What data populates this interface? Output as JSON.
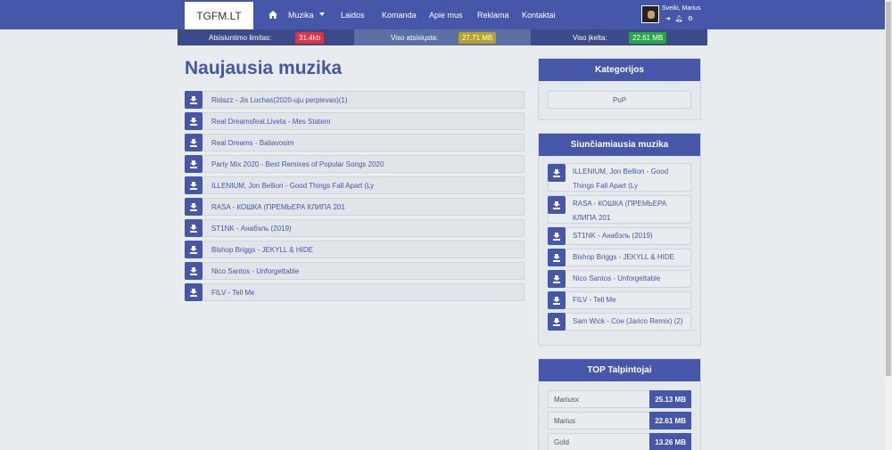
{
  "navbar": {
    "brand": "TGFM.LT",
    "items": [
      {
        "label": "Muzika",
        "has_dropdown": true
      },
      {
        "label": "Laidos"
      },
      {
        "label": "Komanda"
      },
      {
        "label": "Apie mus"
      },
      {
        "label": "Reklama"
      },
      {
        "label": "Kontaktai"
      }
    ],
    "user": {
      "greeting": "Sveiki, Marius",
      "icons": [
        "logout-icon",
        "bell-icon",
        "gear-icon"
      ]
    }
  },
  "stats": {
    "download_limit_label": "Atsisiuntimo limitas:",
    "download_limit_value": "31.4kb",
    "total_downloaded_label": "Viso atsisiųsta:",
    "total_downloaded_value": "27.71 MB",
    "total_uploaded_label": "Viso įkelta:",
    "total_uploaded_value": "22.61 MB"
  },
  "main": {
    "title": "Naujausia muzika",
    "songs": [
      "Ridazz - Jis Lochas(2020-uju perpievas)(1)",
      "Real Dreamsfeat.Liveta - Mes Statem",
      "Real Dreams - Baliavosim",
      "Party Mix 2020 - Best Remixes of Popular Songs 2020",
      "ILLENIUM, Jon Bellion - Good Things Fall Apart (Ly",
      "RASA - КОШКА (ПРЕМЬЕРА КЛИПА 201",
      "ST1NK - Анабэль (2019)",
      "Bishop Briggs - JEKYLL & HIDE",
      "Nico Santos - Unforgettable",
      "FILV - Tell Me"
    ]
  },
  "sidebar": {
    "categories": {
      "title": "Kategorijos",
      "items": [
        "PoP"
      ]
    },
    "top_downloaded": {
      "title": "Siunčiamiausia muzika",
      "songs": [
        "ILLENIUM, Jon Bellion - Good Things Fall Apart (Ly",
        "RASA - КОШКА (ПРЕМЬЕРА КЛИПА 201",
        "ST1NK - Анабэль (2019)",
        "Bishop Briggs - JEKYLL & HIDE",
        "Nico Santos - Unforgettable",
        "FILV - Tell Me",
        "Sam Wick - Сон (Jarico Remix) (2)"
      ]
    },
    "top_uploaders": {
      "title": "TOP Talpintojai",
      "users": [
        {
          "name": "Mariusx",
          "amount": "25.13 MB"
        },
        {
          "name": "Marius",
          "amount": "22.61 MB"
        },
        {
          "name": "Gold",
          "amount": "13.26 MB"
        }
      ]
    }
  },
  "colors": {
    "primary": "#4656a8",
    "background": "#e9ecef",
    "badge_red": "#dc3545",
    "badge_yellow": "#b6a22c",
    "badge_green": "#28a745"
  }
}
